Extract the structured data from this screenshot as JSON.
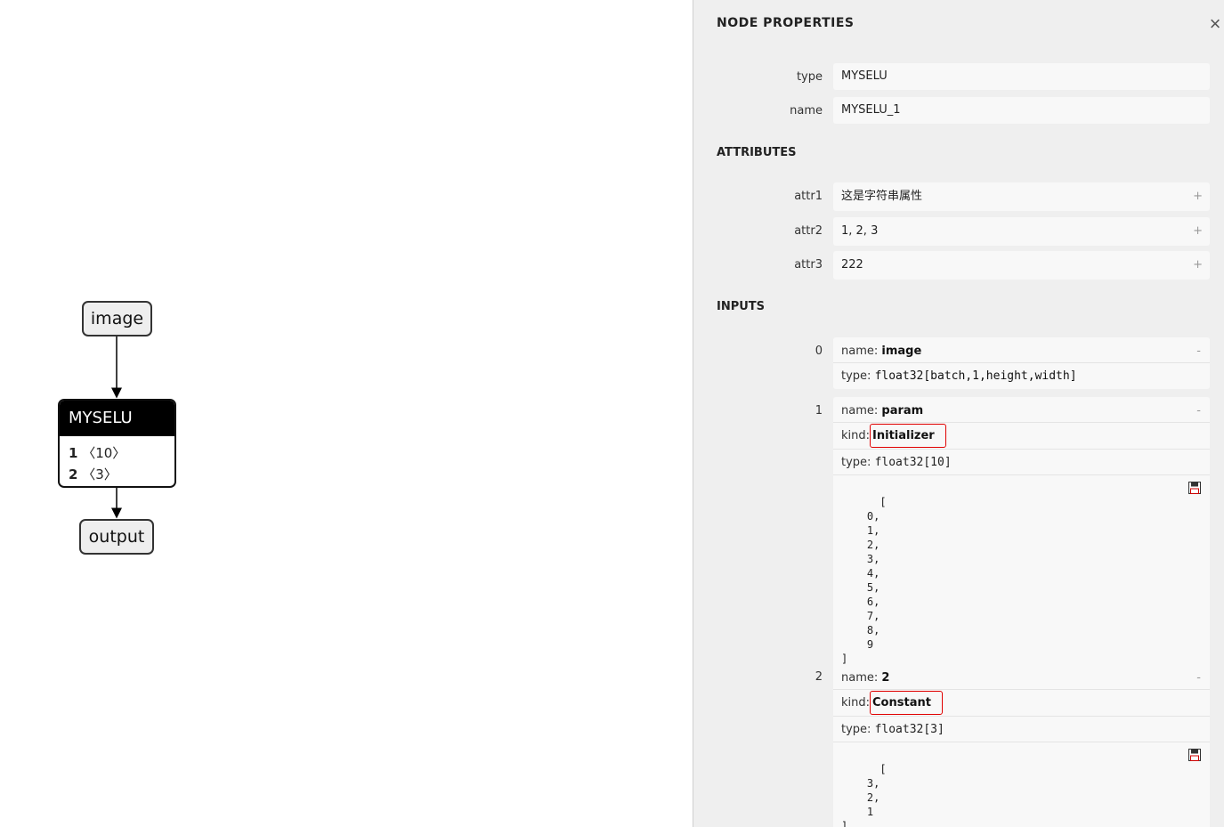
{
  "graph": {
    "input_node": "image",
    "output_node": "output",
    "op_node": {
      "title": "MYSELU",
      "attrs": [
        {
          "index": "1",
          "shape": "〈10〉"
        },
        {
          "index": "2",
          "shape": "〈3〉"
        }
      ]
    }
  },
  "panel": {
    "title": "NODE PROPERTIES",
    "close_icon": "×",
    "properties": [
      {
        "label": "type",
        "value": "MYSELU"
      },
      {
        "label": "name",
        "value": "MYSELU_1"
      }
    ],
    "attributes_title": "ATTRIBUTES",
    "attributes": [
      {
        "label": "attr1",
        "value": "这是字符串属性"
      },
      {
        "label": "attr2",
        "value": "1, 2, 3"
      },
      {
        "label": "attr3",
        "value": "222"
      }
    ],
    "expand_symbol": "+",
    "collapse_symbol": "-",
    "inputs_title": "INPUTS",
    "inputs": [
      {
        "index": "0",
        "name_label": "name: ",
        "name": "image",
        "type_label": "type: ",
        "type": "float32[batch,1,height,width]"
      },
      {
        "index": "1",
        "name_label": "name: ",
        "name": "param",
        "kind_label": "kind:",
        "kind": "Initializer",
        "type_label": "type: ",
        "type": "float32[10]",
        "tensor": "[\n    0,\n    1,\n    2,\n    3,\n    4,\n    5,\n    6,\n    7,\n    8,\n    9\n]"
      },
      {
        "index": "2",
        "name_label": "name: ",
        "name": "2",
        "kind_label": "kind:",
        "kind": "Constant",
        "type_label": "type: ",
        "type": "float32[3]",
        "tensor": "[\n    3,\n    2,\n    1\n]"
      }
    ]
  },
  "colors": {
    "op_header": "#000000",
    "kind_highlight": "#e00000",
    "panel_bg": "#efefef"
  }
}
